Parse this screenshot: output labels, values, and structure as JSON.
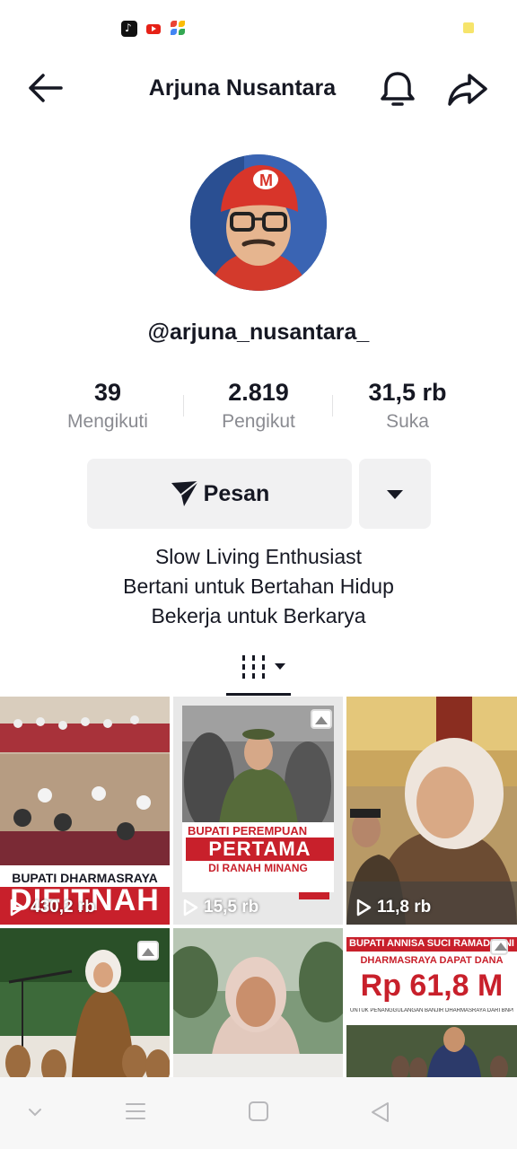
{
  "status_bar": {
    "icons": [
      "tiktok-icon",
      "youtube-icon",
      "pinwheel-icon",
      "battery-icon"
    ]
  },
  "header": {
    "title": "Arjuna Nusantara",
    "icons": [
      "back-arrow-icon",
      "bell-icon",
      "share-icon"
    ]
  },
  "profile": {
    "username": "@arjuna_nusantara_",
    "stats": [
      {
        "value": "39",
        "label": "Mengikuti"
      },
      {
        "value": "2.819",
        "label": "Pengikut"
      },
      {
        "value": "31,5 rb",
        "label": "Suka"
      }
    ],
    "message_button": "Pesan",
    "bio": [
      "Slow Living Enthusiast",
      "Bertani untuk Bertahan Hidup",
      "Bekerja untuk Berkarya"
    ]
  },
  "videos": [
    {
      "overlay": "BUPATI DHARMASRAYA",
      "headline": "DIFITNAH",
      "views": "430,2 rb"
    },
    {
      "overlay": "BUPATI PEREMPUAN",
      "headline": "PERTAMA",
      "subline": "DI RANAH MINANG",
      "views": "15,5 rb"
    },
    {
      "views": "11,8 rb"
    },
    {},
    {},
    {
      "overlay": "BUPATI ANNISA SUCI RAMADHANI",
      "subline": "DHARMASRAYA DAPAT DANA",
      "headline": "Rp 61,8 M",
      "caption": "UNTUK PENANGGULANGAN BANJIR DHARMASRAYA DARI BNPB"
    }
  ],
  "colors": {
    "text": "#161823",
    "muted": "#8a8b91",
    "button_bg": "#f1f1f2",
    "accent_red": "#d71f26"
  }
}
